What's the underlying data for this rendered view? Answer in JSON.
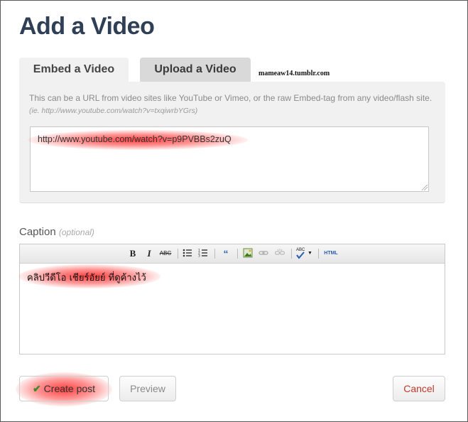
{
  "page": {
    "title": "Add a Video"
  },
  "tabs": [
    {
      "label": "Embed a Video",
      "active": true
    },
    {
      "label": "Upload a Video",
      "active": false
    }
  ],
  "watermark": "mameaw14.tumblr.com",
  "embed": {
    "help_text": "This can be a URL from video sites like YouTube or Vimeo, or the raw Embed-tag from any video/flash site.",
    "help_example": "(ie. http://www.youtube.com/watch?v=txqiwrbYGrs)",
    "url_value": "http://www.youtube.com/watch?v=p9PVBBs2zuQ"
  },
  "caption": {
    "label": "Caption",
    "optional_label": "(optional)",
    "text": "คลิปวีดีโอ เชียร์อัยย์ ที่ดูค้างไว้",
    "toolbar": {
      "bold": "B",
      "italic": "I",
      "strike": "ABC",
      "html": "HTML",
      "spell": "ABC"
    }
  },
  "actions": {
    "create_label": "Create post",
    "preview_label": "Preview",
    "cancel_label": "Cancel"
  },
  "colors": {
    "title": "#2f3f55",
    "cancel": "#c0392b",
    "check": "#3a8a2a",
    "highlight": "#ff2020"
  }
}
